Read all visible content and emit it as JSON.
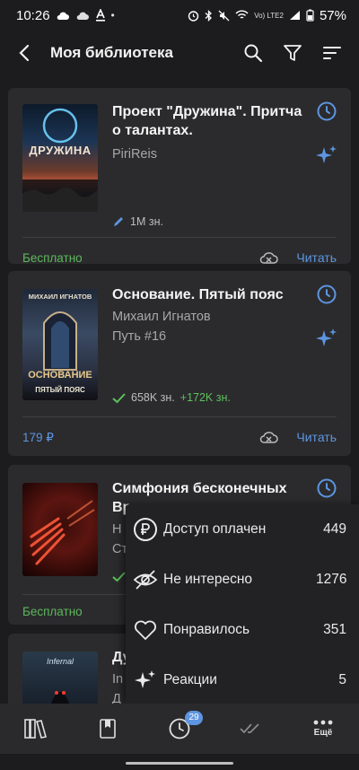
{
  "status": {
    "time": "10:26",
    "battery": "57%",
    "network": "Vo) LTE2"
  },
  "header": {
    "title": "Моя библиотека"
  },
  "books": [
    {
      "title": "Проект \"Дружина\". Притча о талантах.",
      "author": "PiriReis",
      "series": "",
      "meta": "1M зн.",
      "meta_plus": "",
      "price": "Бесплатно",
      "read_label": "Читать",
      "cover_text": "ДРУЖИНА",
      "cover_author": ""
    },
    {
      "title": "Основание. Пятый пояс",
      "author": "Михаил Игнатов",
      "series": "Путь #16",
      "meta": "658K зн.",
      "meta_plus": "+172K зн.",
      "price": "179 ₽",
      "read_label": "Читать",
      "cover_text": "ОСНОВАНИЕ",
      "cover_sub": "ПЯТЫЙ ПОЯС",
      "cover_author": "МИХАИЛ ИГНАТОВ"
    },
    {
      "title": "Симфония бесконечных Вр",
      "author": "Н",
      "series": "Ст",
      "meta": "",
      "meta_plus": "",
      "price": "Бесплатно",
      "read_label": "",
      "cover_text": "",
      "cover_author": ""
    },
    {
      "title": "Ду",
      "author": "In",
      "series": "Д",
      "meta": "",
      "meta_plus": "",
      "price": "",
      "read_label": "",
      "cover_text": "Infernal",
      "cover_author": ""
    }
  ],
  "popup": {
    "items": [
      {
        "label": "Доступ оплачен",
        "count": "449",
        "icon": "ruble-circle-icon"
      },
      {
        "label": "Не интересно",
        "count": "1276",
        "icon": "eye-off-icon"
      },
      {
        "label": "Понравилось",
        "count": "351",
        "icon": "heart-icon"
      },
      {
        "label": "Реакции",
        "count": "5",
        "icon": "sparkle-icon"
      }
    ]
  },
  "nav": {
    "badge": "29",
    "more_label": "Ещё"
  },
  "colors": {
    "accent": "#5d95e0",
    "free": "#5cb85c",
    "card": "#2b2b2d",
    "background": "#1c1c1e"
  }
}
